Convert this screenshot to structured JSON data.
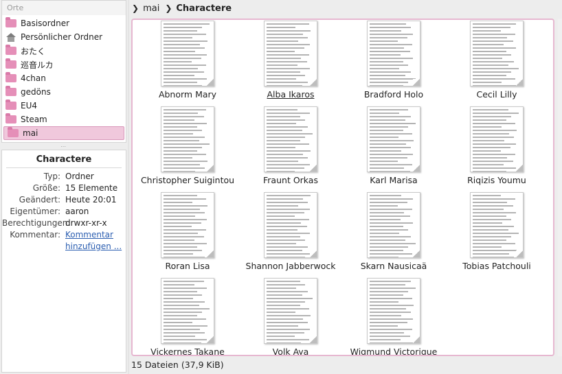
{
  "sidebar": {
    "header": "Orte",
    "places": [
      {
        "label": "Basisordner",
        "icon": "folder-icon"
      },
      {
        "label": "Persönlicher Ordner",
        "icon": "home-icon"
      },
      {
        "label": "おたく",
        "icon": "folder-icon"
      },
      {
        "label": "巡音ルカ",
        "icon": "folder-icon"
      },
      {
        "label": "4chan",
        "icon": "folder-icon"
      },
      {
        "label": "gedöns",
        "icon": "folder-icon"
      },
      {
        "label": "EU4",
        "icon": "folder-icon"
      },
      {
        "label": "Steam",
        "icon": "folder-icon"
      },
      {
        "label": "mai",
        "icon": "folder-icon",
        "selected": true
      }
    ]
  },
  "info": {
    "title": "Charactere",
    "rows": [
      {
        "key": "Typ:",
        "value": "Ordner"
      },
      {
        "key": "Größe:",
        "value": "15 Elemente"
      },
      {
        "key": "Geändert:",
        "value": "Heute 20:01"
      },
      {
        "key": "Eigentümer:",
        "value": "aaron"
      },
      {
        "key": "Berechtigungen:",
        "value": "drwxr-xr-x"
      }
    ],
    "comment_key": "Kommentar:",
    "comment_link_1": "Kommentar",
    "comment_link_2": "hinzufügen ..."
  },
  "breadcrumb": {
    "items": [
      "mai",
      "Charactere"
    ]
  },
  "files": [
    {
      "name": "Abnorm Mary"
    },
    {
      "name": "Alba Ikaros",
      "hover": true
    },
    {
      "name": "Bradford Holo"
    },
    {
      "name": "Cecil Lilly"
    },
    {
      "name": "Christopher Suigintou"
    },
    {
      "name": "Fraunt Orkas"
    },
    {
      "name": "Karl Marisa"
    },
    {
      "name": "Riqizis Youmu"
    },
    {
      "name": "Roran Lisa"
    },
    {
      "name": "Shannon Jabberwock"
    },
    {
      "name": "Skarn Nausicaä"
    },
    {
      "name": "Tobias Patchouli"
    },
    {
      "name": "Vickernes Takane"
    },
    {
      "name": "Volk Aya"
    },
    {
      "name": "Wigmund Victorique"
    }
  ],
  "status": "15 Dateien (37,9 KiB)",
  "colors": {
    "accent": "#e6b7d0",
    "selection": "#f0c8dc",
    "folder": "#e58fb8",
    "link": "#2a5db0"
  }
}
